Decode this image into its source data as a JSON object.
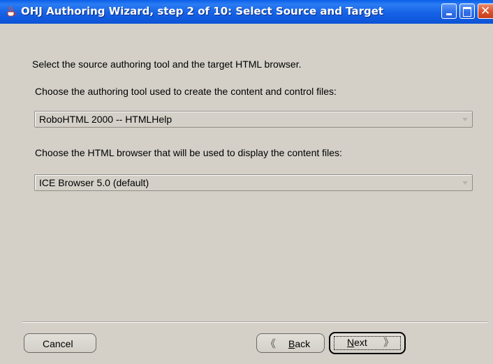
{
  "window": {
    "title": "OHJ Authoring Wizard, step 2 of 10: Select Source and Target",
    "icon": "java-coffee-icon",
    "controls": {
      "minimize": "minimize-icon",
      "maximize": "maximize-icon",
      "close": "close-icon",
      "close_glyph": "✕"
    }
  },
  "content": {
    "intro": "Select the source authoring tool and the target HTML browser.",
    "tool_prompt": "Choose the authoring tool used to create the content and control files:",
    "tool_selected": "RoboHTML 2000 -- HTMLHelp",
    "browser_prompt": "Choose the HTML browser that will be used to display the content files:",
    "browser_selected": "ICE Browser 5.0 (default)"
  },
  "buttons": {
    "cancel": "Cancel",
    "back_mnemonic": "B",
    "back_rest": "ack",
    "back_icon": "《",
    "next_mnemonic": "N",
    "next_rest": "ext",
    "next_icon": "》"
  },
  "colors": {
    "titlebar": "#0b52d6",
    "background": "#d4d0c8",
    "close_button": "#d9522b"
  }
}
